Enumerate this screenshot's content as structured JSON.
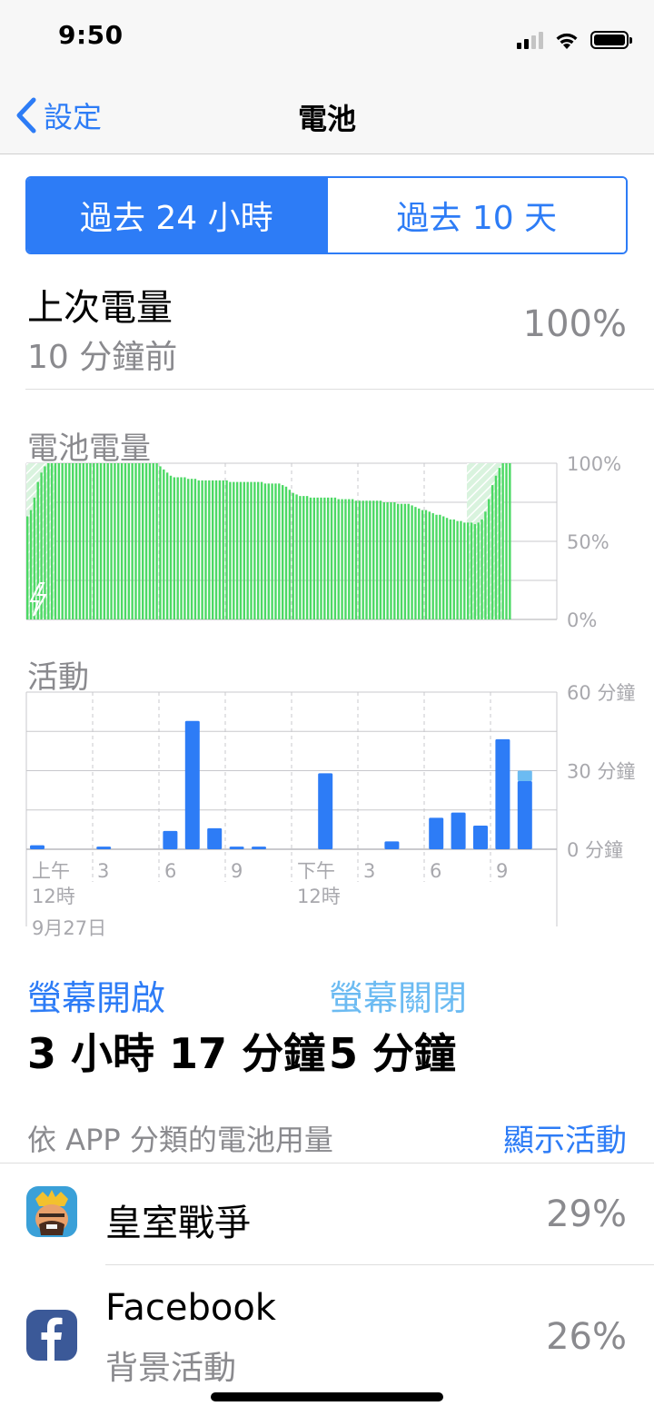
{
  "status_bar": {
    "time": "9:50"
  },
  "nav": {
    "back_label": "設定",
    "title": "電池"
  },
  "segmented": {
    "option_1": "過去 24 小時",
    "option_2": "過去 10 天"
  },
  "last_charge": {
    "label": "上次電量",
    "time": "10 分鐘前",
    "percent": "100%"
  },
  "battery_level_chart": {
    "label": "電池電量",
    "y_ticks": [
      "100%",
      "50%",
      "0%"
    ]
  },
  "activity_chart": {
    "label": "活動",
    "y_ticks": [
      "60 分鐘",
      "30 分鐘",
      "0 分鐘"
    ],
    "x_ticks": [
      "上午",
      "12時",
      "3",
      "6",
      "9",
      "下午",
      "12時",
      "3",
      "6",
      "9"
    ],
    "date_label": "9月27日"
  },
  "chart_data": [
    {
      "type": "bar",
      "title": "電池電量",
      "y_unit": "%",
      "ylim": [
        0,
        100
      ],
      "y_ticks": [
        "100%",
        "50%",
        "0%"
      ],
      "values": [
        66,
        70,
        78,
        88,
        94,
        98,
        100,
        100,
        100,
        100,
        100,
        100,
        100,
        100,
        100,
        100,
        100,
        100,
        100,
        100,
        100,
        100,
        100,
        100,
        100,
        100,
        100,
        100,
        100,
        100,
        100,
        100,
        100,
        100,
        100,
        100,
        100,
        100,
        98,
        96,
        94,
        92,
        91,
        91,
        91,
        91,
        90,
        90,
        90,
        89,
        89,
        89,
        89,
        89,
        89,
        89,
        89,
        89,
        88,
        88,
        88,
        88,
        88,
        88,
        88,
        88,
        88,
        88,
        87,
        87,
        87,
        87,
        87,
        86,
        85,
        83,
        81,
        80,
        79,
        79,
        79,
        78,
        78,
        78,
        78,
        78,
        78,
        78,
        78,
        77,
        77,
        77,
        77,
        77,
        76,
        76,
        76,
        76,
        76,
        76,
        76,
        76,
        75,
        75,
        75,
        75,
        74,
        74,
        74,
        74,
        73,
        72,
        71,
        70,
        70,
        69,
        68,
        67,
        67,
        66,
        65,
        64,
        64,
        63,
        63,
        62,
        62,
        62,
        61,
        62,
        64,
        69,
        77,
        86,
        92,
        97,
        100,
        100,
        100
      ],
      "charging_segments": [
        [
          0,
          7
        ],
        [
          126,
          135
        ]
      ],
      "color": "#4cd964"
    },
    {
      "type": "bar",
      "title": "活動",
      "y_unit": "分鐘",
      "ylim": [
        0,
        60
      ],
      "y_ticks": [
        "60 分鐘",
        "30 分鐘",
        "0 分鐘"
      ],
      "x_ticks": [
        "上午 12時",
        "3",
        "6",
        "9",
        "下午 12時",
        "3",
        "6",
        "9"
      ],
      "date_label": "9月27日",
      "series": [
        {
          "name": "螢幕開啟",
          "color": "#2d7cf6",
          "values": [
            1.5,
            0,
            0,
            1,
            0,
            0,
            7,
            49,
            8,
            1,
            1,
            0,
            0,
            29,
            0,
            0,
            3,
            0,
            12,
            14,
            9,
            42,
            26
          ]
        },
        {
          "name": "螢幕關閉",
          "color": "#6cbbf2",
          "values": [
            0,
            0,
            0,
            0,
            0,
            0,
            0,
            0,
            0,
            0,
            0,
            0,
            0,
            0,
            0,
            0,
            0,
            0,
            0,
            0,
            0,
            0,
            4
          ]
        }
      ]
    }
  ],
  "screen": {
    "on_label": "螢幕開啟",
    "off_label": "螢幕關閉",
    "on_value": "3 小時 17 分鐘",
    "off_value": "5 分鐘"
  },
  "usage": {
    "title": "依 APP 分類的電池用量",
    "show_activity": "顯示活動"
  },
  "apps": [
    {
      "name": "皇室戰爭",
      "sub": "",
      "percent": "29%",
      "icon": "clash-royale-icon"
    },
    {
      "name": "Facebook",
      "sub": "背景活動",
      "percent": "26%",
      "icon": "facebook-icon"
    }
  ]
}
